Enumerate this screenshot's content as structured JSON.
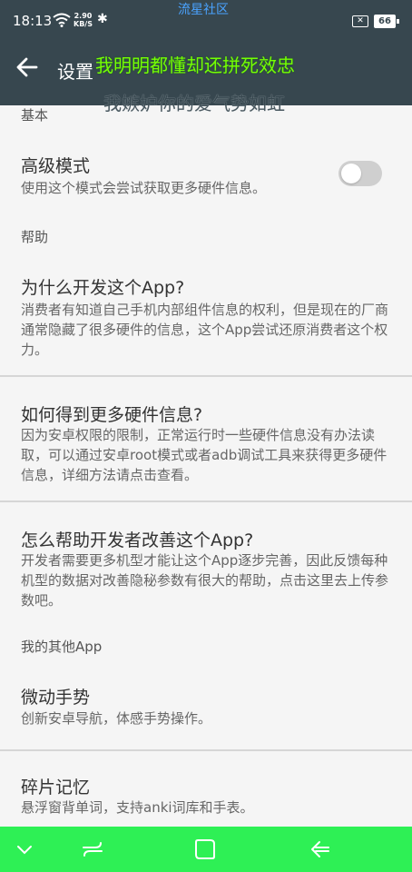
{
  "status_bar": {
    "time": "18:13",
    "net_speed_value": "2.90",
    "net_speed_unit": "KB/S",
    "sim_icon_text": "✕",
    "battery_level": "66",
    "watermark": "流星社区"
  },
  "app_bar": {
    "title": "设置",
    "overlay_line1": "我明明都懂却还拼死效忠",
    "overlay_line2": "我嫉妒你的爱气势如虹",
    "color": "#37474f"
  },
  "sections": {
    "basic": "基本",
    "help": "帮助",
    "other_apps": "我的其他App"
  },
  "items": {
    "advanced_mode": {
      "title": "高级模式",
      "desc": "使用这个模式会尝试获取更多硬件信息。",
      "toggle_on": false
    },
    "why_develop": {
      "title": "为什么开发这个App?",
      "desc": "消费者有知道自己手机内部组件信息的权利，但是现在的厂商通常隐藏了很多硬件的信息，这个App尝试还原消费者这个权力。"
    },
    "more_info": {
      "title": "如何得到更多硬件信息?",
      "desc": "因为安卓权限的限制，正常运行时一些硬件信息没有办法读取，可以通过安卓root模式或者adb调试工具来获得更多硬件信息，详细方法请点击查看。"
    },
    "help_developer": {
      "title": "怎么帮助开发者改善这个App?",
      "desc": "开发者需要更多机型才能让这个App逐步完善，因此反馈每种机型的数据对改善隐秘参数有很大的帮助，点击这里去上传参数吧。"
    },
    "micro_gesture": {
      "title": "微动手势",
      "desc": "创新安卓导航，体感手势操作。"
    },
    "fragment_memory": {
      "title": "碎片记忆",
      "desc": "悬浮窗背单词，支持anki词库和手表。"
    }
  },
  "nav_bar": {
    "color": "#2ef055",
    "icons": [
      "chevron-down-icon",
      "recent-apps-icon",
      "home-icon",
      "back-icon"
    ]
  }
}
